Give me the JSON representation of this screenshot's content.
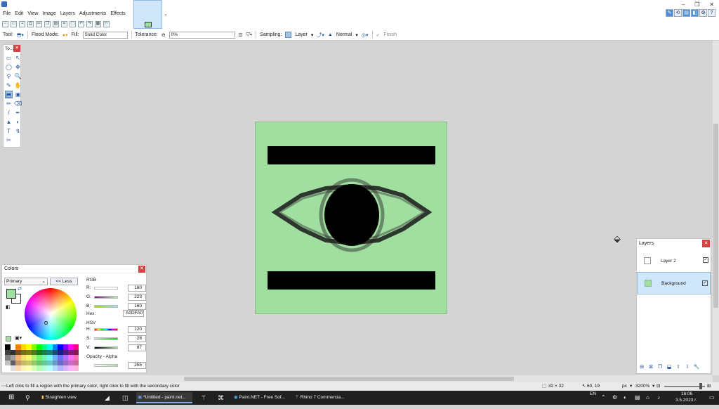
{
  "menu": [
    "File",
    "Edit",
    "View",
    "Image",
    "Layers",
    "Adjustments",
    "Effects"
  ],
  "window_controls": [
    "–",
    "❐",
    "✕"
  ],
  "toolbar": {
    "tool_label": "Tool:",
    "flood_mode_label": "Flood Mode:",
    "fill_label": "Fill:",
    "fill_value": "Solid Color",
    "tolerance_label": "Tolerance:",
    "tolerance_value": "0%",
    "sampling_label": "Sampling:",
    "sampling_value": "Layer",
    "blend_value": "Normal",
    "finish_label": "Finish"
  },
  "tools_panel": {
    "title": "To...",
    "close": "✕"
  },
  "tools": [
    "▭",
    "↖",
    "◯",
    "✥",
    "⚲",
    "🔍",
    "✎",
    "✋",
    "⬒",
    "▣",
    "✏",
    "⌫",
    "/",
    "✒",
    "▲",
    "◐",
    "T",
    "↯",
    "✂"
  ],
  "colors_panel": {
    "title": "Colors",
    "close": "✕",
    "primary_select": "Primary",
    "less_button": "<< Less",
    "rgb_label": "RGB",
    "r_label": "R:",
    "r_value": "160",
    "g_label": "G:",
    "g_value": "223",
    "b_label": "B:",
    "b_value": "160",
    "hex_label": "Hex:",
    "hex_value": "A0DFA0",
    "hsv_label": "HSV",
    "h_label": "H:",
    "h_value": "120",
    "s_label": "S:",
    "s_value": "28",
    "v_label": "V:",
    "v_value": "87",
    "opacity_label": "Opacity - Alpha",
    "opacity_value": "255",
    "primary_color": "#A0DFA0",
    "secondary_color": "#FFFFFF"
  },
  "layers_panel": {
    "title": "Layers",
    "close": "✕",
    "layers": [
      {
        "name": "Layer 2",
        "visible": true,
        "selected": false
      },
      {
        "name": "Background",
        "visible": true,
        "selected": true
      }
    ]
  },
  "statusbar": {
    "hint": "Left click to fill a region with the primary color, right click to fill with the secondary color",
    "selection_size": "32 × 32",
    "cursor_pos": "60, 19",
    "units": "px",
    "zoom": "3200%"
  },
  "taskbar": {
    "items": [
      "Straighten view",
      "*Untitled - paint.net...",
      "Paint.NET - Free Sof...",
      "Rhino 7 Commercia..."
    ],
    "language": "EN",
    "time": "16:06",
    "date": "3.5.2023 г."
  },
  "canvas": {
    "background_color": "#A0DFA0",
    "ink_color": "#000000"
  }
}
